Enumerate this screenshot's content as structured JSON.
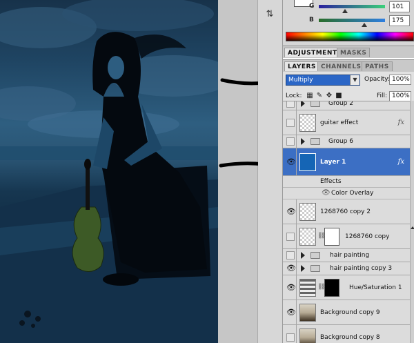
{
  "color_panel": {
    "channels": [
      {
        "label": "G",
        "value": "101",
        "color_from": "#2a1e9e",
        "color_to": "#3bd07a",
        "level": 0.4
      },
      {
        "label": "B",
        "value": "175",
        "color_from": "#2a6d29",
        "color_to": "#2f7fe0",
        "level": 0.69
      }
    ]
  },
  "tabs_top": [
    {
      "label": "ADJUSTMENTS",
      "active": true
    },
    {
      "label": "MASKS",
      "active": false
    }
  ],
  "tabs_layers": [
    {
      "label": "LAYERS",
      "active": true
    },
    {
      "label": "CHANNELS",
      "active": false
    },
    {
      "label": "PATHS",
      "active": false
    }
  ],
  "layers_panel": {
    "blend_mode": "Multiply",
    "opacity_label": "Opacity:",
    "opacity_value": "100%",
    "lock_label": "Lock:",
    "fill_label": "Fill:",
    "fill_value": "100%"
  },
  "layers": [
    {
      "name": "Group 2",
      "type": "group",
      "visible": false
    },
    {
      "name": "guitar effect",
      "type": "layer",
      "visible": false,
      "fx": true
    },
    {
      "name": "Group 6",
      "type": "group",
      "visible": false
    },
    {
      "name": "Layer 1",
      "type": "layer",
      "visible": true,
      "fx": true,
      "selected": true
    },
    {
      "name": "Effects",
      "type": "effects-header"
    },
    {
      "name": "Color Overlay",
      "type": "effect"
    },
    {
      "name": "1268760 copy 2",
      "type": "layer",
      "visible": true
    },
    {
      "name": "1268760 copy",
      "type": "masked",
      "visible": false
    },
    {
      "name": "hair painting",
      "type": "group",
      "visible": false
    },
    {
      "name": "hair painting copy 3",
      "type": "group",
      "visible": true
    },
    {
      "name": "Hue/Saturation 1",
      "type": "adjustment",
      "visible": true
    },
    {
      "name": "Background copy 9",
      "type": "photo",
      "visible": true
    },
    {
      "name": "Background copy 8",
      "type": "photo",
      "visible": false
    }
  ],
  "icons": {
    "fx": "fx",
    "eye": "eye-icon",
    "chain": "link-icon"
  }
}
